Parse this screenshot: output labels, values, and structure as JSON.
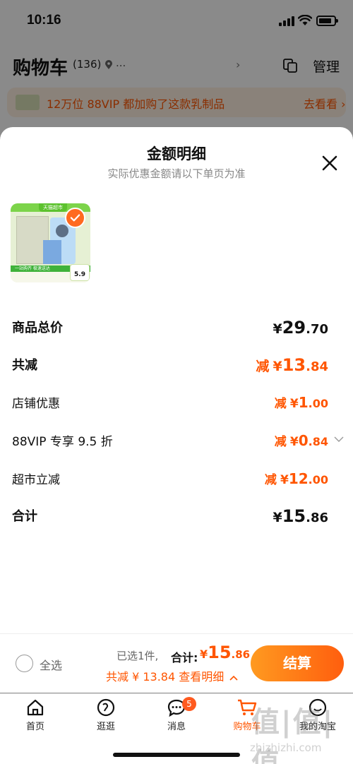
{
  "status_bar": {
    "time": "10:16"
  },
  "cart": {
    "title": "购物车",
    "count": "(136)",
    "location": "...",
    "manage_label": "管理",
    "banner_text": "12万位 88VIP 都加购了这款乳制品",
    "banner_link": "去看看 ›"
  },
  "sheet": {
    "title": "金额明细",
    "subtitle": "实际优惠金额请以下单页为准",
    "product": {
      "top_badge": "天猫超市",
      "strip_text": "一站购齐 极速送达",
      "price_tag": "5.9"
    },
    "rows": [
      {
        "label": "商品总价",
        "prefix": "",
        "symbol": "¥",
        "int": "29",
        "dec": ".70",
        "color": "#111111"
      },
      {
        "label": "共减",
        "prefix": "减",
        "symbol": "¥",
        "int": "13",
        "dec": ".84",
        "color": "#ff5500"
      },
      {
        "label": "店铺优惠",
        "prefix": "减",
        "symbol": "¥",
        "int": "1",
        "dec": ".00",
        "color": "#ff5500"
      },
      {
        "label": "88VIP 专享 9.5 折",
        "prefix": "减",
        "symbol": "¥",
        "int": "0",
        "dec": ".84",
        "color": "#ff5500"
      },
      {
        "label": "超市立减",
        "prefix": "减",
        "symbol": "¥",
        "int": "12",
        "dec": ".00",
        "color": "#ff5500"
      },
      {
        "label": "合计",
        "prefix": "",
        "symbol": "¥",
        "int": "15",
        "dec": ".86",
        "color": "#111111"
      }
    ]
  },
  "checkout": {
    "select_all": "全选",
    "selected_info": "已选1件,",
    "total_label": "合计:",
    "total_symbol": "¥",
    "total_int": "15",
    "total_dec": ".86",
    "saved_text": "共减 ¥ 13.84",
    "detail_link": "查看明细",
    "button": "结算"
  },
  "tabs": [
    {
      "label": "首页",
      "icon": "home-icon"
    },
    {
      "label": "逛逛",
      "icon": "browse-icon"
    },
    {
      "label": "消息",
      "icon": "message-icon",
      "badge": "5"
    },
    {
      "label": "购物车",
      "icon": "cart-icon",
      "active": true
    },
    {
      "label": "我的淘宝",
      "icon": "profile-icon"
    }
  ],
  "watermark": {
    "big": "值|值|值",
    "small": "zhizhizhi.com"
  },
  "colors": {
    "accent": "#ff5500",
    "checkout_gradient_start": "#ff9a20",
    "checkout_gradient_end": "#ff5e0e"
  }
}
